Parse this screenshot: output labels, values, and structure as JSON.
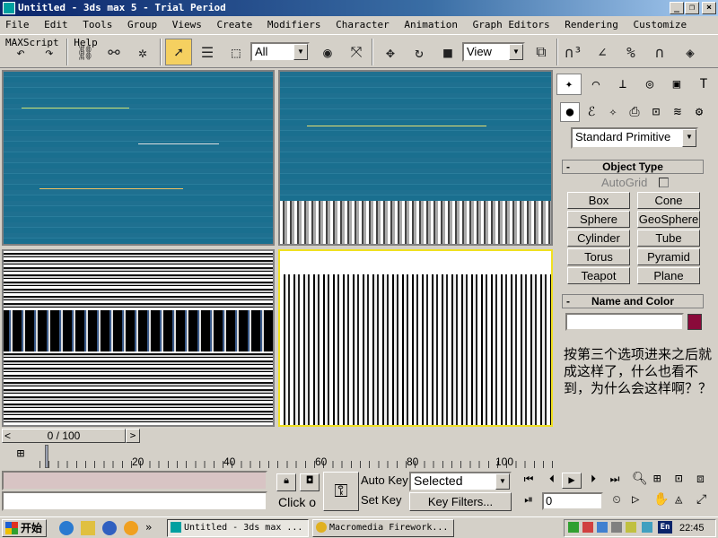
{
  "window": {
    "title": "Untitled - 3ds max 5 - Trial Period"
  },
  "menu": [
    "File",
    "Edit",
    "Tools",
    "Group",
    "Views",
    "Create",
    "Modifiers",
    "Character",
    "Animation",
    "Graph Editors",
    "Rendering",
    "Customize",
    "MAXScript",
    "Help"
  ],
  "toolbar": {
    "selection_filter": "All",
    "reference_coord": "View",
    "icons": [
      "undo-icon",
      "redo-icon",
      "link-icon",
      "unlink-icon",
      "bind-spacewarp-icon",
      "select-icon",
      "select-by-name-icon",
      "region-select-icon",
      "filter-combo",
      "select-manipulate-icon",
      "move-icon",
      "rotate-icon",
      "scale-icon",
      "view-combo",
      "mirror-icon",
      "snap-icon",
      "angle-snap-icon",
      "percent-snap-icon",
      "spinner-snap-icon",
      "render-icon"
    ]
  },
  "command_panel": {
    "dropdown": "Standard Primitive",
    "object_type_title": "Object Type",
    "autogrid": "AutoGrid",
    "buttons": [
      "Box",
      "Cone",
      "Sphere",
      "GeoSphere",
      "Cylinder",
      "Tube",
      "Torus",
      "Pyramid",
      "Teapot",
      "Plane"
    ],
    "name_color_title": "Name and Color",
    "name_value": "",
    "color_swatch": "#8a0a3a",
    "note": "按第三个选项进来之后就成这样了，什么也看不到，为什么会这样啊？？"
  },
  "timeline": {
    "frame_label": "0 / 100",
    "ruler_labels": [
      "20",
      "40",
      "60",
      "80",
      "100"
    ]
  },
  "bottom": {
    "prompt": "Click o",
    "auto_key": "Auto Key",
    "set_key": "Set Key",
    "key_mode": "Selected",
    "key_filters": "Key Filters...",
    "frame_field": "0"
  },
  "taskbar": {
    "start": "开始",
    "tasks": [
      "Untitled - 3ds max ...",
      "Macromedia Firework..."
    ],
    "clock": "22:45",
    "lang": "En"
  }
}
